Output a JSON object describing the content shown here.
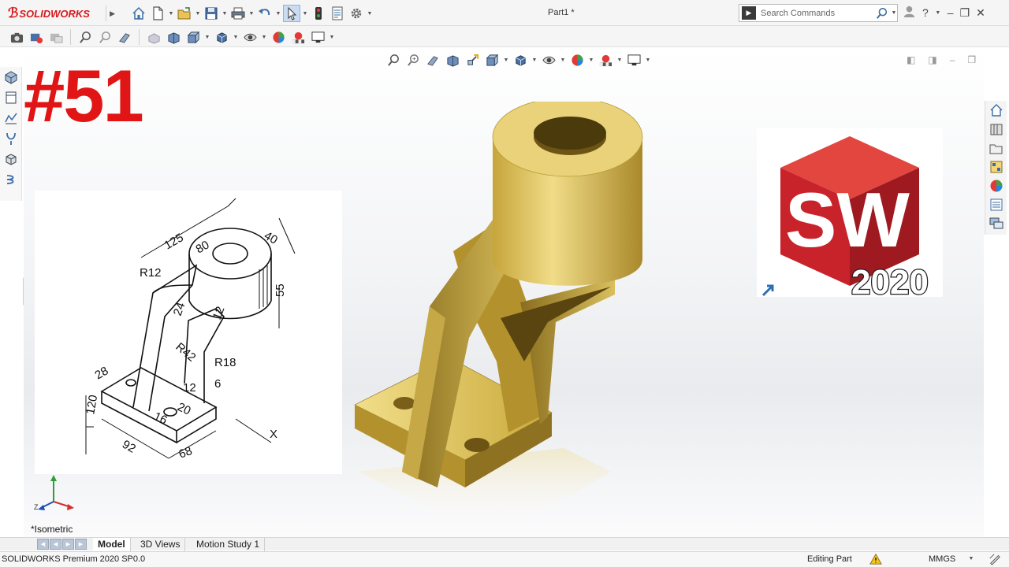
{
  "app": {
    "brand": "SOLIDWORKS",
    "document_title": "Part1 *"
  },
  "search": {
    "placeholder": "Search Commands"
  },
  "window_controls": {
    "help": "?",
    "minimize": "–",
    "restore": "❐",
    "close": "✕"
  },
  "overlay": {
    "episode_number": "#51"
  },
  "sketch": {
    "dims": [
      "125",
      "80",
      "40",
      "R12",
      "55",
      "R42",
      "24",
      "12",
      "R18",
      "6",
      "120",
      "28",
      "92",
      "68",
      "16",
      "20",
      "12",
      "X"
    ]
  },
  "logo_badge": {
    "letters": "SW",
    "year": "2020"
  },
  "triad": {
    "y": "Y",
    "z": "Z",
    "x": "X"
  },
  "view": {
    "label": "*Isometric"
  },
  "tabs": [
    {
      "label": "Model",
      "active": true
    },
    {
      "label": "3D Views",
      "active": false
    },
    {
      "label": "Motion Study 1",
      "active": false
    }
  ],
  "status": {
    "product": "SOLIDWORKS Premium 2020 SP0.0",
    "mode": "Editing Part",
    "units": "MMGS"
  },
  "colors": {
    "accent_red": "#e11515",
    "brand_red": "#d7191c",
    "model_gold": "#c9a93a",
    "logo_cube": "#c8232a"
  }
}
